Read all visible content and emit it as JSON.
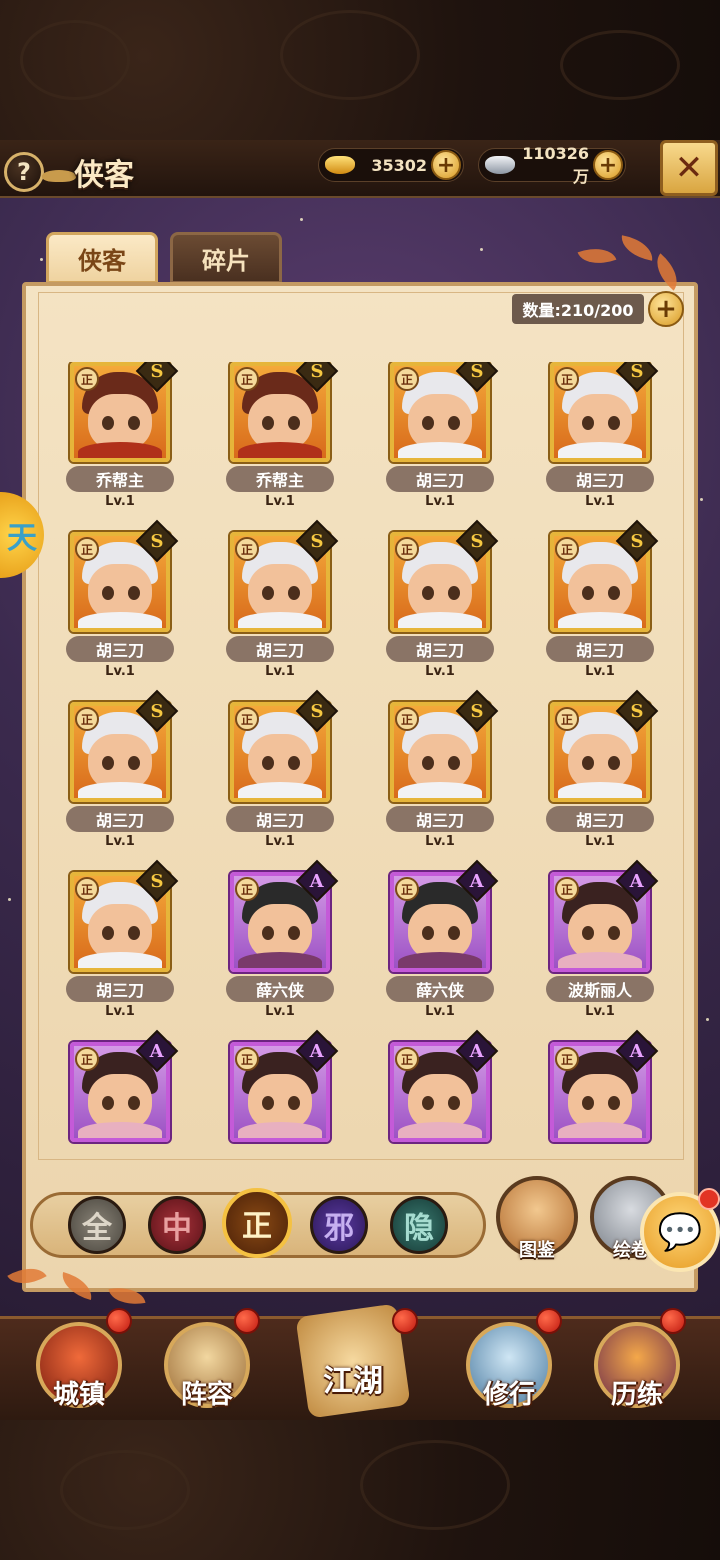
{
  "header": {
    "title": "侠客",
    "help_label": "?",
    "gold": "35302",
    "silver": "110326万",
    "plus_label": "+",
    "close_label": "✕"
  },
  "tabs": [
    {
      "label": "侠客",
      "active": true
    },
    {
      "label": "碎片",
      "active": false
    }
  ],
  "inventory": {
    "count_text": "数量:210/200",
    "plus_label": "+"
  },
  "heroes": [
    {
      "name": "乔帮主",
      "level": "Lv.1",
      "rank": "S",
      "faction": "正"
    },
    {
      "name": "乔帮主",
      "level": "Lv.1",
      "rank": "S",
      "faction": "正"
    },
    {
      "name": "胡三刀",
      "level": "Lv.1",
      "rank": "S",
      "faction": "正"
    },
    {
      "name": "胡三刀",
      "level": "Lv.1",
      "rank": "S",
      "faction": "正"
    },
    {
      "name": "胡三刀",
      "level": "Lv.1",
      "rank": "S",
      "faction": "正"
    },
    {
      "name": "胡三刀",
      "level": "Lv.1",
      "rank": "S",
      "faction": "正"
    },
    {
      "name": "胡三刀",
      "level": "Lv.1",
      "rank": "S",
      "faction": "正"
    },
    {
      "name": "胡三刀",
      "level": "Lv.1",
      "rank": "S",
      "faction": "正"
    },
    {
      "name": "胡三刀",
      "level": "Lv.1",
      "rank": "S",
      "faction": "正"
    },
    {
      "name": "胡三刀",
      "level": "Lv.1",
      "rank": "S",
      "faction": "正"
    },
    {
      "name": "胡三刀",
      "level": "Lv.1",
      "rank": "S",
      "faction": "正"
    },
    {
      "name": "胡三刀",
      "level": "Lv.1",
      "rank": "S",
      "faction": "正"
    },
    {
      "name": "胡三刀",
      "level": "Lv.1",
      "rank": "S",
      "faction": "正"
    },
    {
      "name": "薛六侠",
      "level": "Lv.1",
      "rank": "A",
      "faction": "正"
    },
    {
      "name": "薛六侠",
      "level": "Lv.1",
      "rank": "A",
      "faction": "正"
    },
    {
      "name": "波斯丽人",
      "level": "Lv.1",
      "rank": "A",
      "faction": "正"
    },
    {
      "name": "",
      "level": "",
      "rank": "A",
      "faction": "正"
    },
    {
      "name": "",
      "level": "",
      "rank": "A",
      "faction": "正"
    },
    {
      "name": "",
      "level": "",
      "rank": "A",
      "faction": "正"
    },
    {
      "name": "",
      "level": "",
      "rank": "A",
      "faction": "正"
    }
  ],
  "filters": [
    "全",
    "中",
    "正",
    "邪",
    "隐"
  ],
  "selected_filter": "正",
  "side_buttons": {
    "tujian": "图鉴",
    "huijuan": "绘卷",
    "chat": "💬"
  },
  "side_tab": "天",
  "nav": [
    {
      "label": "城镇",
      "badge": true
    },
    {
      "label": "阵容",
      "badge": true
    },
    {
      "label": "江湖",
      "badge": true
    },
    {
      "label": "修行",
      "badge": true
    },
    {
      "label": "历练",
      "badge": true
    }
  ],
  "colors": {
    "accent_gold": "#e6b53a",
    "rank_S": "#f6c842",
    "rank_A": "#c45ad8",
    "badge_red": "#e23424"
  }
}
